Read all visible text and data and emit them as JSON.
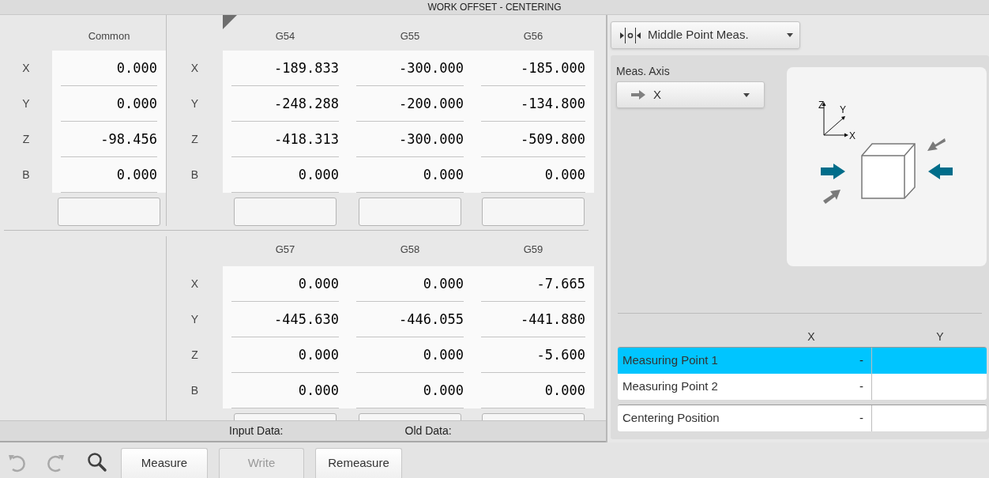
{
  "window": {
    "title": "WORK OFFSET - CENTERING"
  },
  "common": {
    "label": "Common",
    "axes": [
      "X",
      "Y",
      "Z",
      "B"
    ],
    "values": [
      "0.000",
      "0.000",
      "-98.456",
      "0.000"
    ]
  },
  "offset_groups": [
    {
      "axes": [
        "X",
        "Y",
        "Z",
        "B"
      ],
      "columns": [
        {
          "label": "G54",
          "values": [
            "-189.833",
            "-248.288",
            "-418.313",
            "0.000"
          ]
        },
        {
          "label": "G55",
          "values": [
            "-300.000",
            "-200.000",
            "-300.000",
            "0.000"
          ]
        },
        {
          "label": "G56",
          "values": [
            "-185.000",
            "-134.800",
            "-509.800",
            "0.000"
          ]
        }
      ]
    },
    {
      "axes": [
        "X",
        "Y",
        "Z",
        "B"
      ],
      "columns": [
        {
          "label": "G57",
          "values": [
            "0.000",
            "-445.630",
            "0.000",
            "0.000"
          ]
        },
        {
          "label": "G58",
          "values": [
            "0.000",
            "-446.055",
            "0.000",
            "0.000"
          ]
        },
        {
          "label": "G59",
          "values": [
            "-7.665",
            "-441.880",
            "-5.600",
            "0.000"
          ]
        }
      ]
    }
  ],
  "data_strip": {
    "input_label": "Input Data:",
    "old_label": "Old Data:"
  },
  "toolbar": {
    "buttons": [
      {
        "label": "Measure",
        "disabled": false
      },
      {
        "label": "Write",
        "disabled": true
      },
      {
        "label": "Remeasure",
        "disabled": false
      }
    ]
  },
  "method_dropdown": {
    "value": "Middle Point Meas."
  },
  "meas_axis": {
    "label": "Meas. Axis",
    "value": "X"
  },
  "diagram": {
    "axis_labels": [
      "Z",
      "Y",
      "X"
    ]
  },
  "results": {
    "columns": [
      "X",
      "Y"
    ],
    "rows": [
      {
        "label": "Measuring Point 1",
        "x": "-",
        "selected": true
      },
      {
        "label": "Measuring Point 2",
        "x": "-",
        "selected": false
      }
    ],
    "centering": {
      "label": "Centering Position",
      "x": "-"
    }
  }
}
